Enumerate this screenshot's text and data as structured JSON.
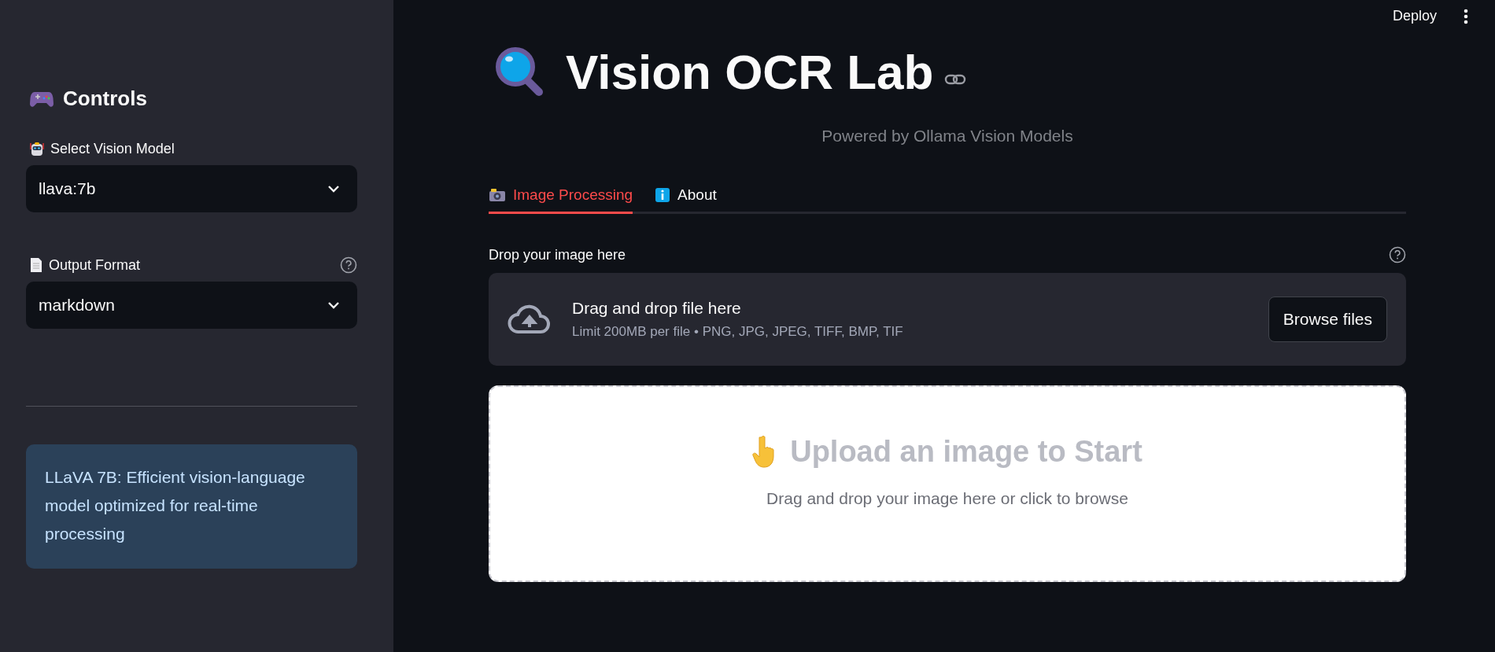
{
  "header": {
    "deploy": "Deploy"
  },
  "sidebar": {
    "title": "Controls",
    "selects": [
      {
        "label": "Select Vision Model",
        "value": "llava:7b",
        "help": false
      },
      {
        "label": "Output Format",
        "value": "markdown",
        "help": true
      }
    ],
    "info": "LLaVA 7B: Efficient vision-language model optimized for real-time processing"
  },
  "main": {
    "title": "Vision OCR Lab",
    "subtitle": "Powered by Ollama Vision Models",
    "tabs": [
      {
        "label": "Image Processing",
        "selected": true
      },
      {
        "label": "About",
        "selected": false
      }
    ],
    "uploader": {
      "label": "Drop your image here",
      "heading": "Drag and drop file here",
      "limit": "Limit 200MB per file • PNG, JPG, JPEG, TIFF, BMP, TIF",
      "button": "Browse files"
    },
    "dropzone": {
      "heading": "Upload an image to Start",
      "hint": "Drag and drop your image here or click to browse"
    }
  }
}
